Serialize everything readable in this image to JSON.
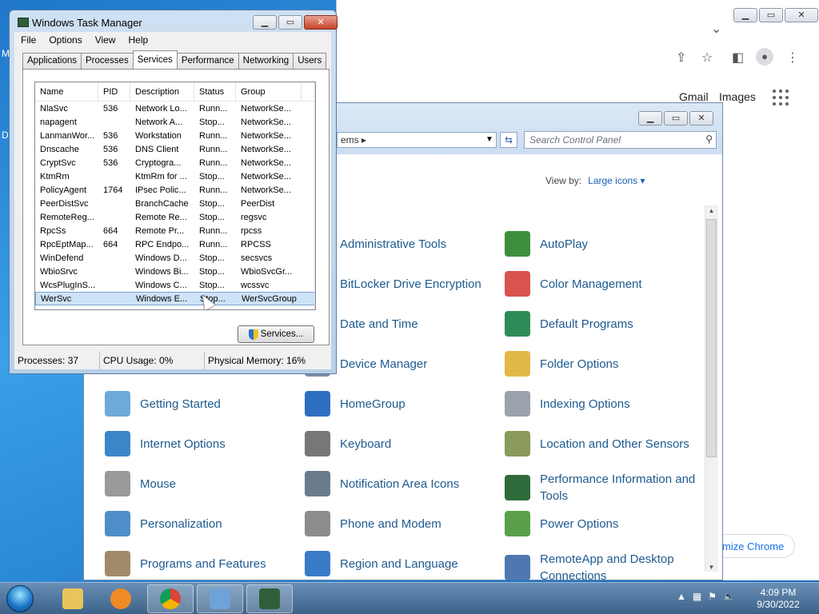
{
  "desktop": {
    "edge_letters": [
      "M",
      "D"
    ]
  },
  "chrome": {
    "links": {
      "gmail": "Gmail",
      "images": "Images"
    },
    "customize_label": "mize Chrome",
    "icons": [
      "share-icon",
      "star-icon",
      "sidebar-icon",
      "profile-icon",
      "menu-icon"
    ]
  },
  "control_panel": {
    "address_text": "ems",
    "search_placeholder": "Search Control Panel",
    "view_by_label": "View by:",
    "view_by_value": "Large icons",
    "items": [
      {
        "label": "Administrative Tools",
        "icon": "admin-tools-icon",
        "color": "#5b7fa8"
      },
      {
        "label": "AutoPlay",
        "icon": "autoplay-icon",
        "color": "#3d8f3d"
      },
      {
        "label": "BitLocker Drive Encryption",
        "icon": "bitlocker-icon",
        "color": "#8a8a8a"
      },
      {
        "label": "Color Management",
        "icon": "color-management-icon",
        "color": "#d9534f"
      },
      {
        "label": "Date and Time",
        "icon": "clock-icon",
        "color": "#6a8fbd"
      },
      {
        "label": "Default Programs",
        "icon": "default-programs-icon",
        "color": "#2e8b57"
      },
      {
        "label": "Device Manager",
        "icon": "device-manager-icon",
        "color": "#7a8fa6"
      },
      {
        "label": "Folder Options",
        "icon": "folder-icon",
        "color": "#e2b84a"
      },
      {
        "label": "Getting Started",
        "icon": "getting-started-icon",
        "color": "#6fa9d8"
      },
      {
        "label": "HomeGroup",
        "icon": "homegroup-icon",
        "color": "#2f6fc0"
      },
      {
        "label": "Indexing Options",
        "icon": "indexing-icon",
        "color": "#9aa3ad"
      },
      {
        "label": "Internet Options",
        "icon": "internet-options-icon",
        "color": "#3b86c8"
      },
      {
        "label": "Keyboard",
        "icon": "keyboard-icon",
        "color": "#777777"
      },
      {
        "label": "Location and Other Sensors",
        "icon": "location-sensors-icon",
        "color": "#8a9a5b"
      },
      {
        "label": "Mouse",
        "icon": "mouse-icon",
        "color": "#9a9a9a"
      },
      {
        "label": "Notification Area Icons",
        "icon": "notification-area-icon",
        "color": "#6b7b8c"
      },
      {
        "label": "Performance Information and Tools",
        "icon": "performance-icon",
        "color": "#2f6b3b"
      },
      {
        "label": "Personalization",
        "icon": "personalization-icon",
        "color": "#4f8fc9"
      },
      {
        "label": "Phone and Modem",
        "icon": "phone-modem-icon",
        "color": "#8c8c8c"
      },
      {
        "label": "Power Options",
        "icon": "power-options-icon",
        "color": "#5aa04b"
      },
      {
        "label": "Programs and Features",
        "icon": "programs-features-icon",
        "color": "#a08a6a"
      },
      {
        "label": "Region and Language",
        "icon": "region-language-icon",
        "color": "#3a7bc8"
      },
      {
        "label": "RemoteApp and Desktop Connections",
        "icon": "remoteapp-icon",
        "color": "#4f78b0"
      }
    ]
  },
  "task_manager": {
    "title": "Windows Task Manager",
    "menu": [
      "File",
      "Options",
      "View",
      "Help"
    ],
    "tabs": [
      "Applications",
      "Processes",
      "Services",
      "Performance",
      "Networking",
      "Users"
    ],
    "active_tab": "Services",
    "columns": [
      "Name",
      "PID",
      "Description",
      "Status",
      "Group"
    ],
    "rows": [
      [
        "NlaSvc",
        "536",
        "Network Lo...",
        "Runn...",
        "NetworkSe..."
      ],
      [
        "napagent",
        "",
        "Network A...",
        "Stop...",
        "NetworkSe..."
      ],
      [
        "LanmanWor...",
        "536",
        "Workstation",
        "Runn...",
        "NetworkSe..."
      ],
      [
        "Dnscache",
        "536",
        "DNS Client",
        "Runn...",
        "NetworkSe..."
      ],
      [
        "CryptSvc",
        "536",
        "Cryptogra...",
        "Runn...",
        "NetworkSe..."
      ],
      [
        "KtmRm",
        "",
        "KtmRm for ...",
        "Stop...",
        "NetworkSe..."
      ],
      [
        "PolicyAgent",
        "1764",
        "IPsec Polic...",
        "Runn...",
        "NetworkSe..."
      ],
      [
        "PeerDistSvc",
        "",
        "BranchCache",
        "Stop...",
        "PeerDist"
      ],
      [
        "RemoteReg...",
        "",
        "Remote Re...",
        "Stop...",
        "regsvc"
      ],
      [
        "RpcSs",
        "664",
        "Remote Pr...",
        "Runn...",
        "rpcss"
      ],
      [
        "RpcEptMap...",
        "664",
        "RPC Endpo...",
        "Runn...",
        "RPCSS"
      ],
      [
        "WinDefend",
        "",
        "Windows D...",
        "Stop...",
        "secsvcs"
      ],
      [
        "WbioSrvc",
        "",
        "Windows Bi...",
        "Stop...",
        "WbioSvcGr..."
      ],
      [
        "WcsPlugInS...",
        "",
        "Windows C...",
        "Stop...",
        "wcssvc"
      ],
      [
        "WerSvc",
        "",
        "Windows E...",
        "Stop...",
        "WerSvcGroup"
      ]
    ],
    "selected_row": 14,
    "services_button": "Services...",
    "status": {
      "processes": "Processes: 37",
      "cpu": "CPU Usage: 0%",
      "memory": "Physical Memory: 16%"
    }
  },
  "taskbar": {
    "clock_time": "4:09 PM",
    "clock_date": "9/30/2022"
  }
}
